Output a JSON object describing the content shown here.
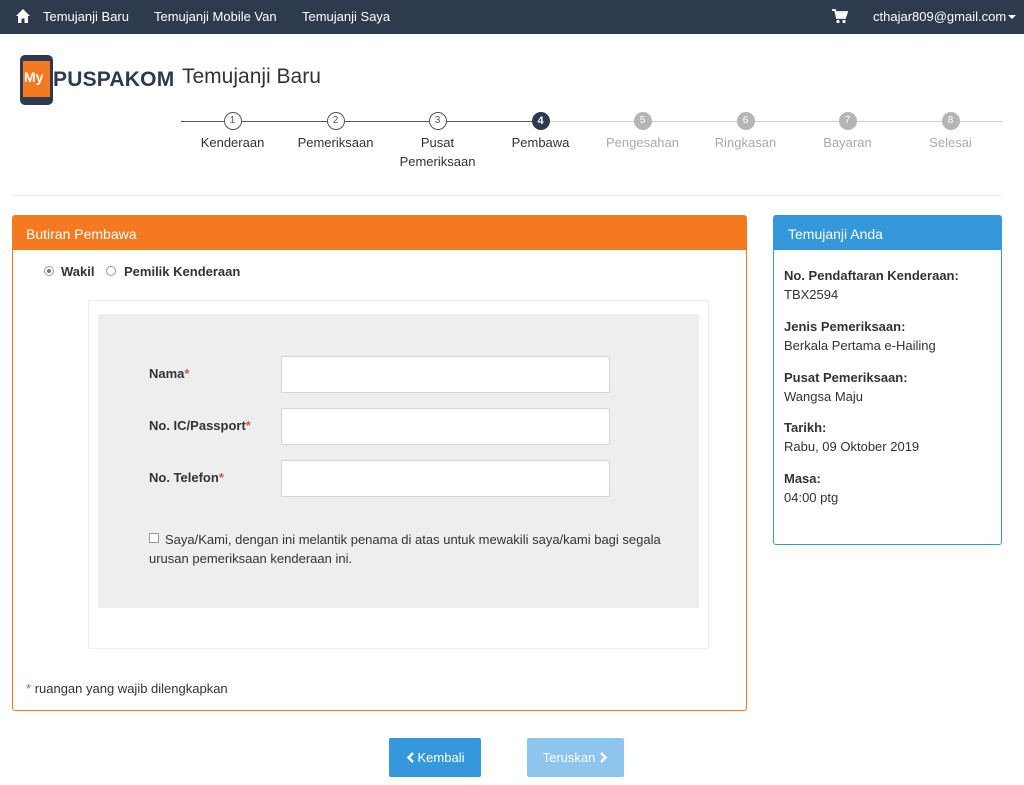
{
  "topnav": {
    "home_icon": "home-icon",
    "links": [
      "Temujanji Baru",
      "Temujanji Mobile Van",
      "Temujanji Saya"
    ],
    "cart_icon": "cart-icon",
    "user_email": "cthajar809@gmail.com"
  },
  "logo": {
    "my": "My",
    "brand": "PUSPAKOM"
  },
  "page_title": "Temujanji Baru",
  "steps": [
    {
      "num": "1",
      "label": "Kenderaan",
      "state": "done"
    },
    {
      "num": "2",
      "label": "Pemeriksaan",
      "state": "done"
    },
    {
      "num": "3",
      "label": "Pusat Pemeriksaan",
      "state": "done"
    },
    {
      "num": "4",
      "label": "Pembawa",
      "state": "active"
    },
    {
      "num": "5",
      "label": "Pengesahan",
      "state": "todo"
    },
    {
      "num": "6",
      "label": "Ringkasan",
      "state": "todo"
    },
    {
      "num": "7",
      "label": "Bayaran",
      "state": "todo"
    },
    {
      "num": "8",
      "label": "Selesai",
      "state": "todo"
    }
  ],
  "main_panel": {
    "title": "Butiran Pembawa",
    "radio_options": [
      {
        "label": "Wakil",
        "selected": true
      },
      {
        "label": "Pemilik Kenderaan",
        "selected": false
      }
    ],
    "fields": [
      {
        "label": "Nama",
        "required_mark": "*",
        "value": ""
      },
      {
        "label": "No. IC/Passport",
        "required_mark": "*",
        "value": ""
      },
      {
        "label": "No. Telefon",
        "required_mark": "*",
        "value": ""
      }
    ],
    "consent_text": "Saya/Kami, dengan ini melantik penama di atas untuk mewakili saya/kami bagi segala urusan pemeriksaan kenderaan ini.",
    "consent_checked": false,
    "required_mark": "*",
    "required_note": "ruangan yang wajib dilengkapkan"
  },
  "side_panel": {
    "title": "Temujanji Anda",
    "items": [
      {
        "key": "No. Pendaftaran Kenderaan:",
        "value": "TBX2594"
      },
      {
        "key": "Jenis Pemeriksaan:",
        "value": "Berkala Pertama e-Hailing"
      },
      {
        "key": "Pusat Pemeriksaan:",
        "value": "Wangsa Maju"
      },
      {
        "key": "Tarikh:",
        "value": "Rabu, 09 Oktober 2019"
      },
      {
        "key": "Masa:",
        "value": "04:00 ptg"
      }
    ]
  },
  "buttons": {
    "back_label": "Kembali",
    "back_icon": "chevron-left-icon",
    "next_label": "Teruskan",
    "next_icon": "chevron-right-icon"
  },
  "colors": {
    "nav_bg": "#2e3b4e",
    "accent_orange": "#f47920",
    "accent_blue": "#3498db",
    "disabled_blue": "#8ec5ec",
    "required_red": "#d9534f"
  }
}
